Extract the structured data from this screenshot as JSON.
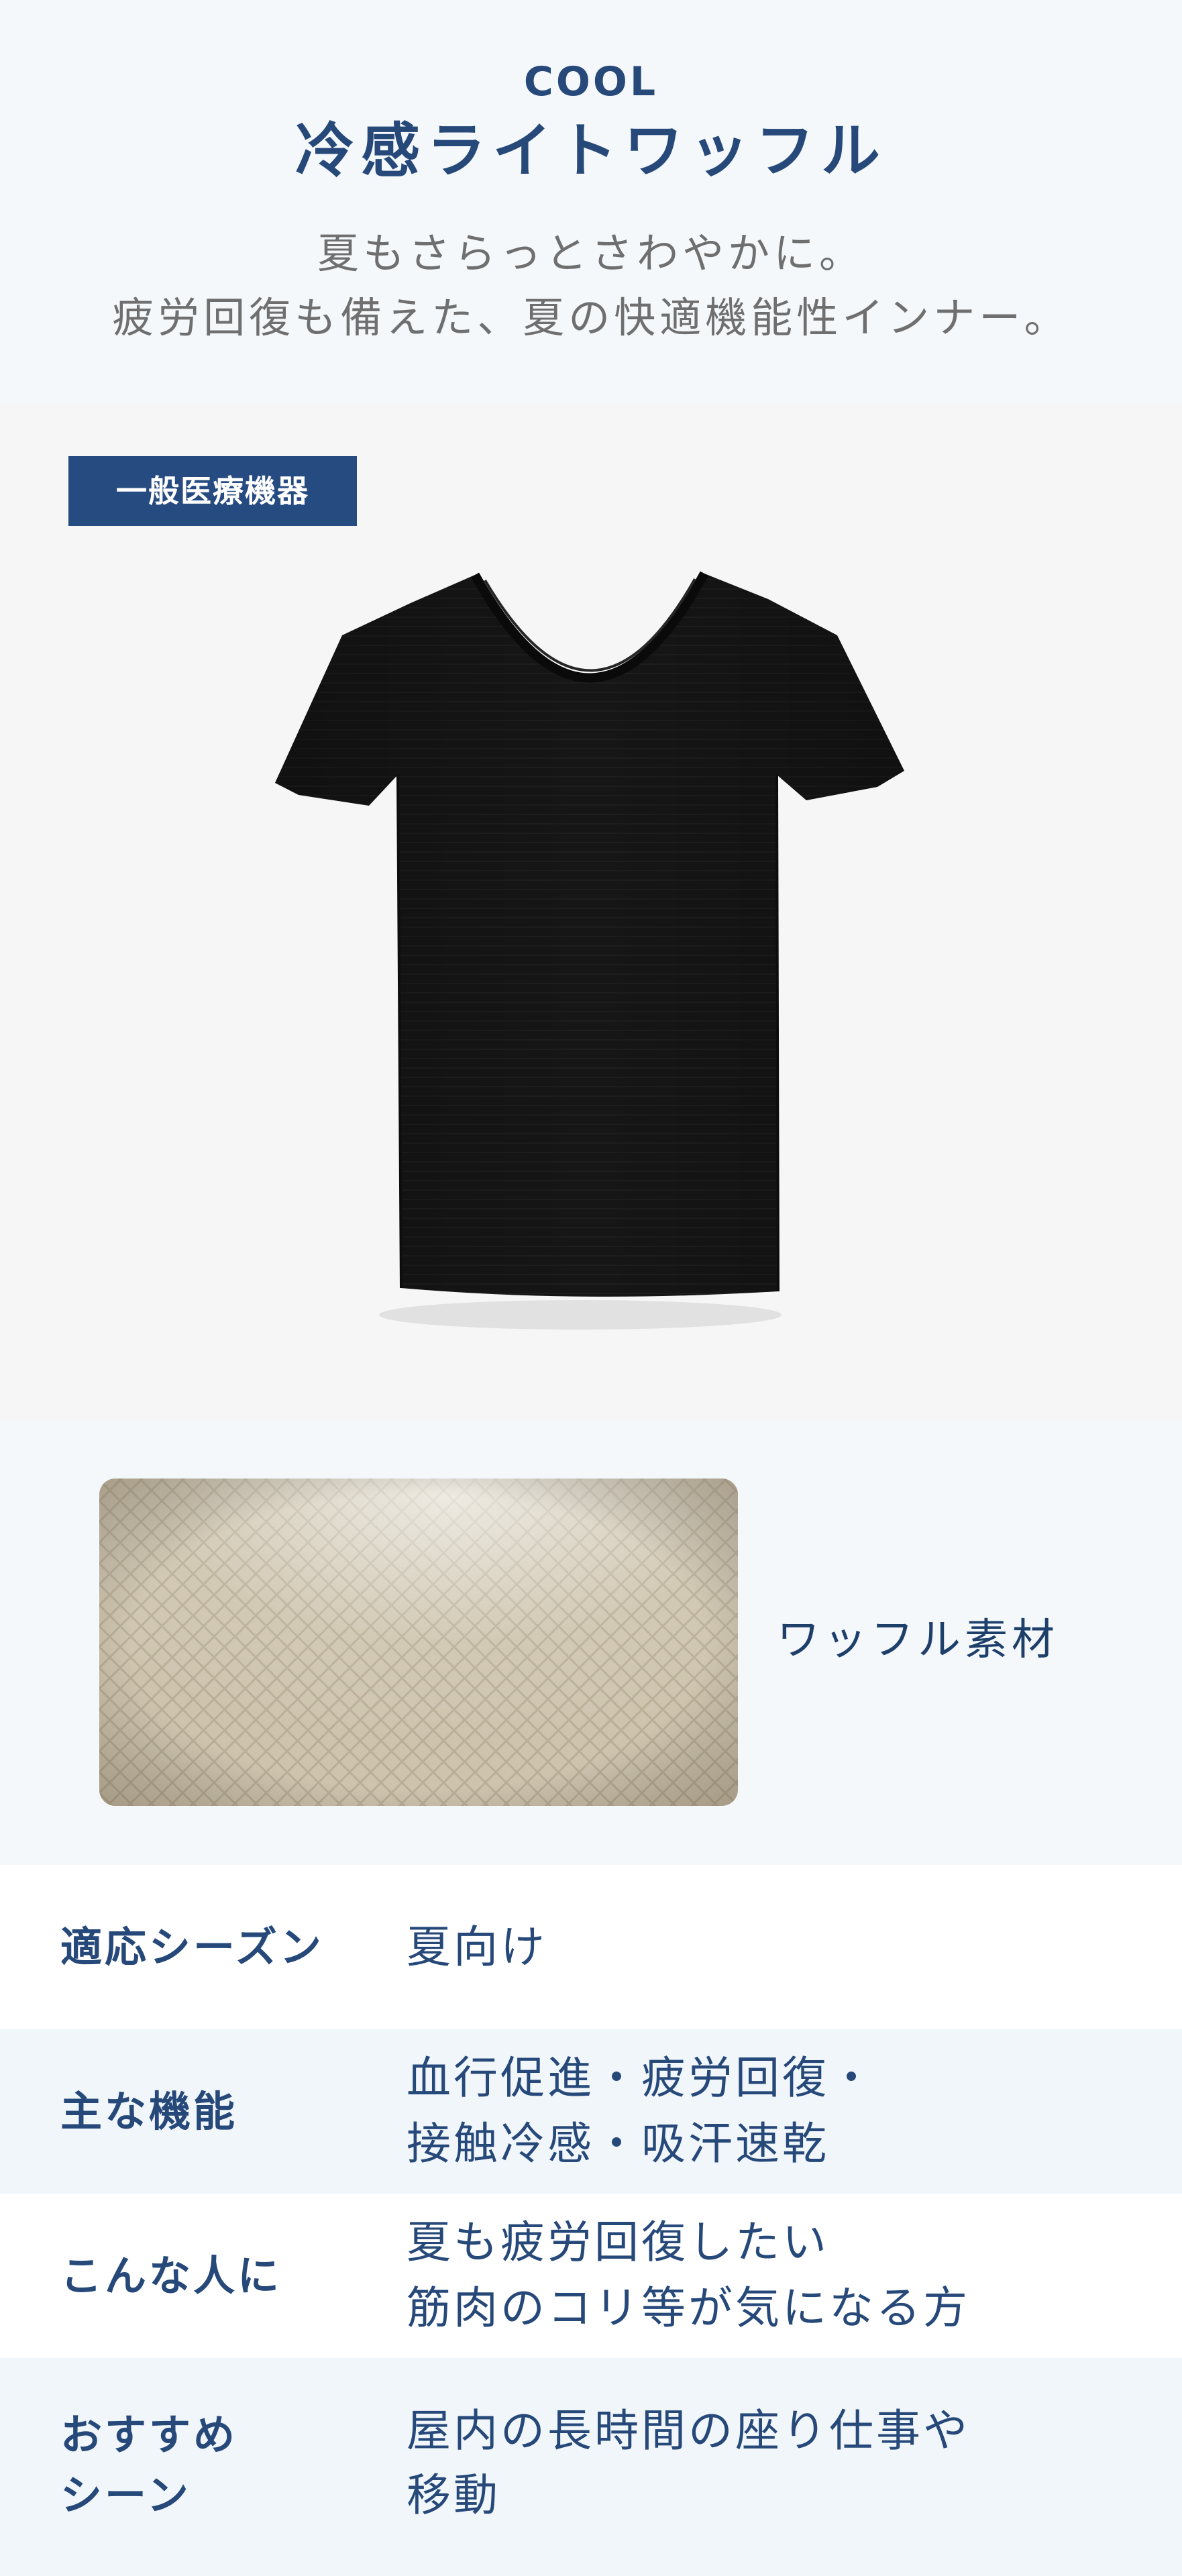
{
  "header": {
    "eyebrow": "COOL",
    "title": "冷感ライトワッフル",
    "subtitle_line1": "夏もさらっとさわやかに。",
    "subtitle_line2": "疲労回復も備えた、夏の快適機能性インナー。"
  },
  "product": {
    "badge": "一般医療機器",
    "image_icon": "black-vneck-tshirt-image",
    "shirt_color": "#161616"
  },
  "material": {
    "swatch_icon": "waffle-fabric-swatch-image",
    "label": "ワッフル素材",
    "swatch_color": "#cfc6b2"
  },
  "specs": [
    {
      "key": "適応シーズン",
      "value_lines": [
        "夏向け"
      ]
    },
    {
      "key": "主な機能",
      "value_lines": [
        "血行促進・疲労回復・",
        "接触冷感・吸汗速乾"
      ]
    },
    {
      "key": "こんな人に",
      "value_lines": [
        "夏も疲労回復したい",
        "筋肉のコリ等が気になる方"
      ]
    },
    {
      "key_lines": [
        "おすすめ",
        "シーン"
      ],
      "value_lines": [
        "屋内の長時間の座り仕事や",
        "移動"
      ]
    }
  ],
  "colors": {
    "brand_navy": "#26497a",
    "badge_bg": "#264b80",
    "page_bg": "#f4f8fb",
    "subtitle_gray": "#6f6f6f"
  }
}
